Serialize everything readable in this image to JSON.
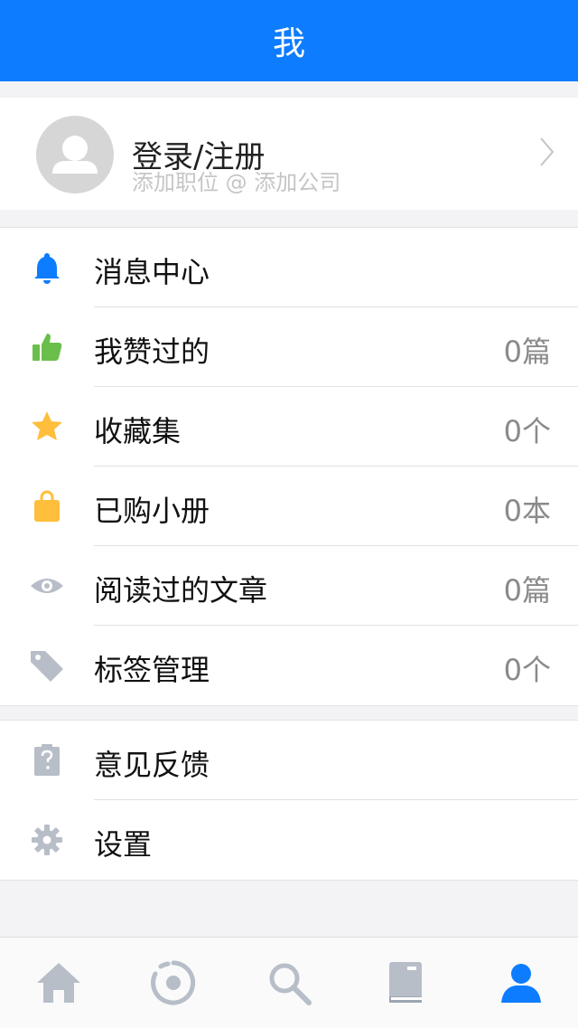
{
  "header": {
    "title": "我"
  },
  "profile": {
    "name": "登录/注册",
    "subtitle": "添加职位 @ 添加公司"
  },
  "menu1": [
    {
      "icon": "bell-icon",
      "label": "消息中心",
      "count": ""
    },
    {
      "icon": "thumbs-up-icon",
      "label": "我赞过的",
      "count": "0篇"
    },
    {
      "icon": "star-icon",
      "label": "收藏集",
      "count": "0个"
    },
    {
      "icon": "shopping-bag-icon",
      "label": "已购小册",
      "count": "0本"
    },
    {
      "icon": "eye-icon",
      "label": "阅读过的文章",
      "count": "0篇"
    },
    {
      "icon": "tag-icon",
      "label": "标签管理",
      "count": "0个"
    }
  ],
  "menu2": [
    {
      "icon": "feedback-icon",
      "label": "意见反馈"
    },
    {
      "icon": "gear-icon",
      "label": "设置"
    }
  ],
  "tabbar": {
    "items": [
      "home-icon",
      "activity-icon",
      "search-icon",
      "book-icon",
      "profile-icon"
    ],
    "active": "profile-icon"
  },
  "colors": {
    "accent": "#0d7cff",
    "green": "#6abf4b",
    "orange": "#ffbe3c",
    "gray_icon": "#b7bec8"
  }
}
